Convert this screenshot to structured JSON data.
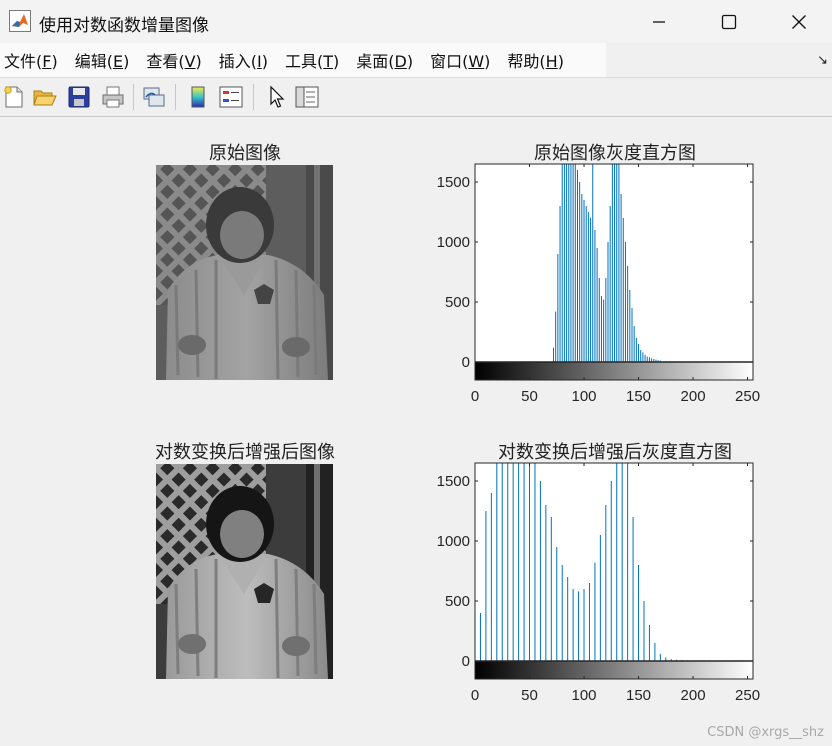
{
  "window": {
    "title": "使用对数函数增量图像",
    "controls": [
      "minimize",
      "maximize",
      "close"
    ]
  },
  "menu": {
    "items": [
      {
        "label": "文件(",
        "key": "F",
        "tail": ")"
      },
      {
        "label": "编辑(",
        "key": "E",
        "tail": ")"
      },
      {
        "label": "查看(",
        "key": "V",
        "tail": ")"
      },
      {
        "label": "插入(",
        "key": "I",
        "tail": ")"
      },
      {
        "label": "工具(",
        "key": "T",
        "tail": ")"
      },
      {
        "label": "桌面(",
        "key": "D",
        "tail": ")"
      },
      {
        "label": "窗口(",
        "key": "W",
        "tail": ")"
      },
      {
        "label": "帮助(",
        "key": "H",
        "tail": ")"
      }
    ],
    "overflow_arrow": "↘"
  },
  "toolbar": {
    "icons": [
      "new-file-icon",
      "open-folder-icon",
      "save-icon",
      "print-icon",
      "link-plot-icon",
      "colorbar-icon",
      "legend-icon",
      "pointer-icon",
      "property-editor-icon"
    ]
  },
  "figure": {
    "panel1_title": "原始图像",
    "panel2_title": "原始图像灰度直方图",
    "panel3_title": "对数变换后增强后图像",
    "panel4_title": "对数变换后增强后灰度直方图"
  },
  "chart_data": [
    {
      "type": "bar",
      "title": "原始图像灰度直方图",
      "xlim": [
        0,
        255
      ],
      "ylim": [
        -150,
        1650
      ],
      "xticks": [
        0,
        50,
        100,
        150,
        200,
        250
      ],
      "yticks": [
        0,
        500,
        1000,
        1500
      ],
      "series": [
        {
          "color": "#0072BD",
          "x": [
            72,
            74,
            76,
            78,
            80,
            82,
            84,
            86,
            88,
            90,
            92,
            94,
            96,
            98,
            100,
            102,
            104,
            106,
            108,
            110,
            112,
            114,
            116,
            118,
            120,
            122,
            124,
            126,
            128,
            130,
            132,
            134,
            136,
            138,
            140,
            142,
            144,
            146,
            148,
            150,
            152,
            154,
            156,
            158,
            160,
            162,
            164,
            166,
            168,
            170,
            175,
            180,
            185,
            190,
            195,
            200,
            210,
            220,
            230,
            240,
            250
          ],
          "values": [
            120,
            420,
            900,
            1300,
            1650,
            1650,
            1650,
            1650,
            1650,
            1650,
            1650,
            1600,
            1500,
            1400,
            1350,
            1300,
            1250,
            1200,
            1650,
            1100,
            950,
            700,
            550,
            520,
            700,
            1000,
            1300,
            1650,
            1650,
            1650,
            1650,
            1400,
            1200,
            1000,
            800,
            600,
            450,
            300,
            200,
            150,
            100,
            80,
            60,
            45,
            40,
            30,
            25,
            20,
            15,
            12,
            8,
            6,
            5,
            4,
            3,
            3,
            2,
            2,
            1,
            1,
            1
          ]
        }
      ],
      "colorbar": "gray"
    },
    {
      "type": "bar",
      "title": "对数变换后增强后灰度直方图",
      "xlim": [
        0,
        255
      ],
      "ylim": [
        -150,
        1650
      ],
      "xticks": [
        0,
        50,
        100,
        150,
        200,
        250
      ],
      "yticks": [
        0,
        500,
        1000,
        1500
      ],
      "series": [
        {
          "color": "#0072BD",
          "x": [
            5,
            10,
            15,
            20,
            25,
            30,
            35,
            40,
            45,
            50,
            55,
            60,
            65,
            70,
            75,
            80,
            85,
            90,
            95,
            100,
            105,
            110,
            115,
            120,
            125,
            130,
            135,
            140,
            145,
            150,
            155,
            160,
            165,
            170,
            175,
            180,
            185,
            190,
            195,
            200,
            205,
            210,
            215,
            220,
            225,
            230,
            235,
            240,
            245,
            250
          ],
          "values": [
            400,
            1250,
            1400,
            1650,
            1650,
            1650,
            1650,
            1650,
            1650,
            1650,
            1650,
            1500,
            1300,
            1200,
            950,
            800,
            700,
            600,
            580,
            600,
            650,
            820,
            1050,
            1300,
            1500,
            1650,
            1650,
            1650,
            1200,
            800,
            500,
            300,
            150,
            60,
            30,
            15,
            10,
            8,
            6,
            5,
            5,
            5,
            5,
            5,
            5,
            5,
            5,
            5,
            5,
            5
          ]
        }
      ],
      "colorbar": "gray"
    }
  ],
  "watermark": "CSDN @xrgs__shz"
}
